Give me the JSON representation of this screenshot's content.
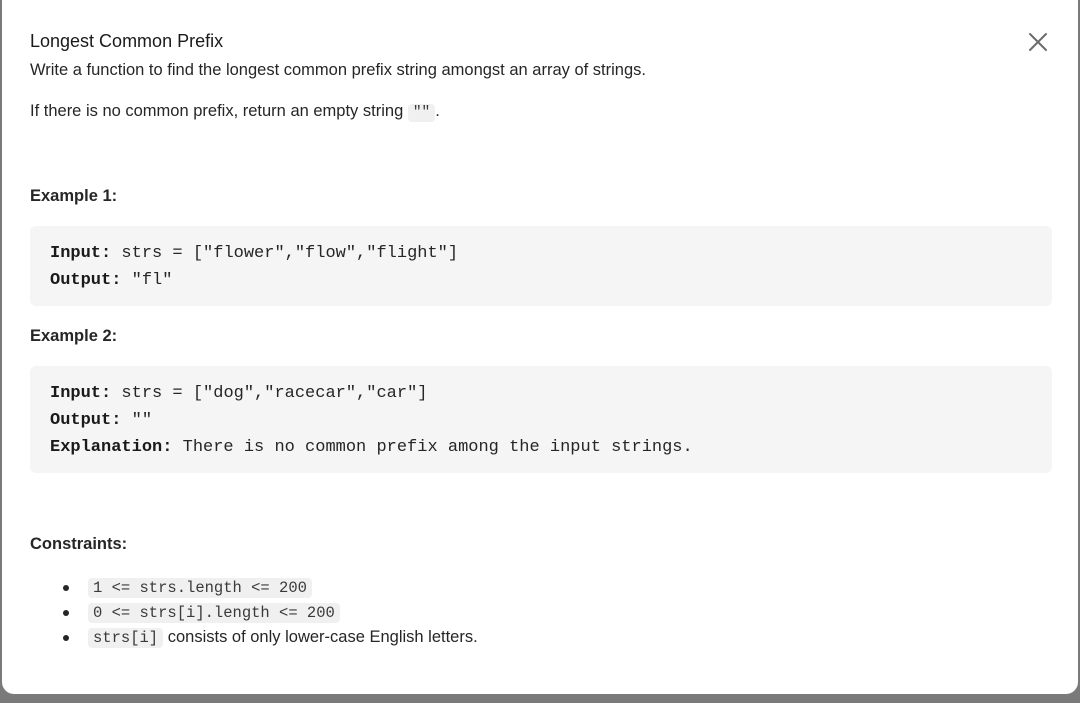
{
  "problem": {
    "title": "Longest Common Prefix",
    "description_1": "Write a function to find the longest common prefix string amongst an array of strings.",
    "description_2_text": "If there is no common prefix, return an empty string",
    "description_2_code": "\"\"",
    "description_2_end": "."
  },
  "examples": [
    {
      "title": "Example 1:",
      "input_label": "Input:",
      "input_value": "strs = [\"flower\",\"flow\",\"flight\"]",
      "output_label": "Output:",
      "output_value": "\"fl\""
    },
    {
      "title": "Example 2:",
      "input_label": "Input:",
      "input_value": "strs = [\"dog\",\"racecar\",\"car\"]",
      "output_label": "Output:",
      "output_value": "\"\"",
      "explanation_label": "Explanation:",
      "explanation_value": "There is no common prefix among the input strings."
    }
  ],
  "constraints": {
    "title": "Constraints:",
    "items": [
      {
        "code": "1 <= strs.length <= 200",
        "text": ""
      },
      {
        "code": "0 <= strs[i].length <= 200",
        "text": ""
      },
      {
        "code": "strs[i]",
        "text": "consists of only lower-case English letters."
      }
    ]
  },
  "icons": {
    "close": "close-icon"
  }
}
